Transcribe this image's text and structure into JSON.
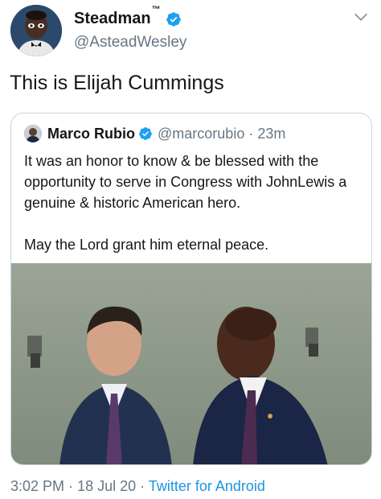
{
  "tweet": {
    "display_name": "Steadman",
    "trademark": "™",
    "handle": "@AsteadWesley",
    "text": "This is Elijah Cummings",
    "time": "3:02 PM",
    "date": "18 Jul 20",
    "source": "Twitter for Android",
    "separator": "·"
  },
  "quoted_tweet": {
    "display_name": "Marco Rubio",
    "handle": "@marcorubio",
    "separator": "·",
    "time": "23m",
    "paragraphs": [
      "It was an honor to know & be blessed with the opportunity to serve in Congress with JohnLewis a genuine & historic American hero.",
      "May the Lord grant him eternal peace."
    ]
  },
  "icons": {
    "verified": "verified-badge-icon",
    "menu": "chevron-down-icon"
  },
  "colors": {
    "verified_blue": "#1da1f2",
    "link_blue": "#1b95e0",
    "secondary_text": "#657786",
    "border": "#ccd6dd"
  }
}
